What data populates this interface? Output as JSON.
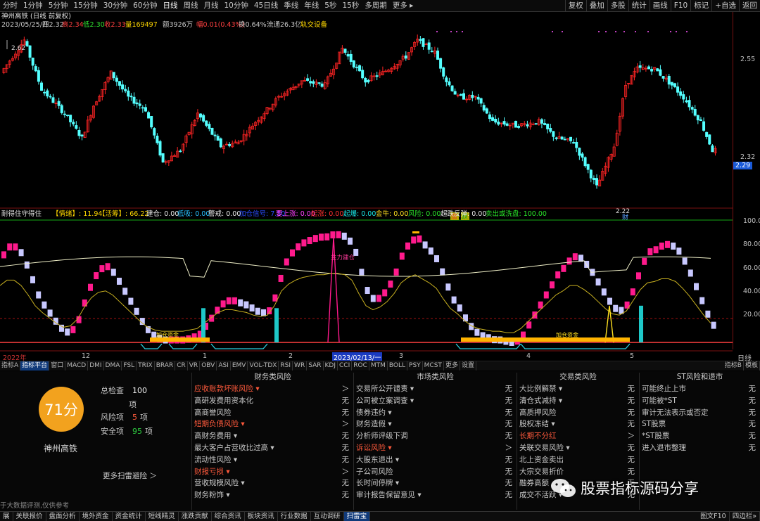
{
  "toolbar": {
    "items": [
      "分时",
      "1分钟",
      "5分钟",
      "15分钟",
      "30分钟",
      "60分钟",
      "日线",
      "周线",
      "月线",
      "10分钟",
      "45日线",
      "季线",
      "年线",
      "5秒",
      "15秒",
      "多周期",
      "更多 ▸"
    ],
    "right": [
      "复权",
      "叠加",
      "多股",
      "统计",
      "画线",
      "F10",
      "标记",
      "+自选",
      "返回"
    ]
  },
  "header": {
    "title": "神州高铁 (日线 前复权)",
    "date": "2023/05/25/四",
    "open": "开2.32",
    "high": "高2.34",
    "low": "低2.30",
    "close": "收2.33",
    "vol": "量169497",
    "amount": "额3926万",
    "change": "幅0.01(0.43%)",
    "turnover": "换0.64%",
    "float": "流通26.3亿",
    "indicator": "轨交设备"
  },
  "price_axis": {
    "labels": [
      "2.55",
      "2.32"
    ],
    "current": "2.29",
    "high_mark": "2.62",
    "low_mark": "2.22",
    "cai": "财"
  },
  "markers": {
    "rise": "涨",
    "fall": "跌"
  },
  "indicator": {
    "name": "耐得住守得住",
    "v1": "【情绪】: 11.94",
    "v2": "【活筹】: 66.22",
    "items": [
      {
        "t": "建仓: 0.00",
        "c": "#e8e8e8"
      },
      {
        "t": "低吸: 0.00",
        "c": "#28c0ff"
      },
      {
        "t": "警戒: 0.00",
        "c": "#e8e8e8"
      },
      {
        "t": "加仓信号: 7.50",
        "c": "#2a4cff"
      },
      {
        "t": "要上涨: 0.00",
        "c": "#ff40ff"
      },
      {
        "t": "起涨: 0.00",
        "c": "#ff3030"
      },
      {
        "t": "起爆: 0.00",
        "c": "#19e6e6"
      },
      {
        "t": "金牛: 0.00",
        "c": "#ffe020"
      },
      {
        "t": "风险: 0.00",
        "c": "#28e028"
      },
      {
        "t": "超跌反弹: 0.00",
        "c": "#e8e8e8"
      },
      {
        "t": "卖出或洗盘: 100.00",
        "c": "#28e028"
      }
    ],
    "axis": [
      "100.0",
      "80.00",
      "60.00",
      "40.00",
      "20.00"
    ],
    "label1": "主力建仓",
    "label2": "加仓资金"
  },
  "dates": [
    "2022年",
    "12",
    "1",
    "2",
    "2023/02/13/一",
    "3",
    "4",
    "5"
  ],
  "dates_right": "日线",
  "tabs": [
    "指标A",
    "指标平台",
    "窗口",
    "MACD",
    "DMI",
    "DMA",
    "FSL",
    "TRIX",
    "BRAR",
    "CR",
    "VR",
    "OBV",
    "ASI",
    "EMV",
    "VOL-TDX",
    "RSI",
    "WR",
    "SAR",
    "KDJ",
    "CCI",
    "ROC",
    "MTM",
    "BOLL",
    "PSY",
    "MCST",
    "更多",
    "设置"
  ],
  "tabs_right": [
    "指标B",
    "模板"
  ],
  "risk": {
    "score": "71分",
    "company": "神州高铁",
    "total_label": "总检查",
    "total": "100",
    "unit": "项",
    "risk_label": "风险项",
    "risk_count": "5",
    "risk_unit": "项",
    "safe_label": "安全项",
    "safe_count": "95",
    "safe_unit": "项",
    "more": "更多扫雷避险 ＞",
    "disclaimer": "于大数据评测,仅供参考",
    "columns": [
      {
        "title": "财务类风险",
        "rows": [
          {
            "n": "应收账款坏账风险 ▾",
            "v": "＞",
            "w": true
          },
          {
            "n": "高研发费用资本化",
            "v": "无"
          },
          {
            "n": "高商誉风险",
            "v": "无"
          },
          {
            "n": "短期负债风险 ▾",
            "v": "＞",
            "w": true
          },
          {
            "n": "高财务费用 ▾",
            "v": "无"
          },
          {
            "n": "最大客户占营收比过高 ▾",
            "v": "无"
          },
          {
            "n": "流动性风险 ▾",
            "v": "无"
          },
          {
            "n": "财报亏损 ▾",
            "v": "＞",
            "w": true
          },
          {
            "n": "营收规模风险 ▾",
            "v": "无"
          },
          {
            "n": "财务粉饰 ▾",
            "v": "无"
          }
        ]
      },
      {
        "title": "市场类风险",
        "rows": [
          {
            "n": "交易所公开谴责 ▾",
            "v": "无"
          },
          {
            "n": "公司被立案调查 ▾",
            "v": "无"
          },
          {
            "n": "债券违约 ▾",
            "v": "无"
          },
          {
            "n": "财务造假 ▾",
            "v": "无"
          },
          {
            "n": "分析师评级下调",
            "v": "无"
          },
          {
            "n": "诉讼风险 ▾",
            "v": "＞",
            "w": true
          },
          {
            "n": "大股东退出 ▾",
            "v": "无"
          },
          {
            "n": "子公司风险",
            "v": "无"
          },
          {
            "n": "长时间停牌 ▾",
            "v": "无"
          },
          {
            "n": "审计报告保留意见 ▾",
            "v": "无"
          }
        ]
      },
      {
        "title": "交易类风险",
        "rows": [
          {
            "n": "大比例解禁 ▾",
            "v": "无"
          },
          {
            "n": "清仓式减持 ▾",
            "v": "无"
          },
          {
            "n": "高质押风险",
            "v": "无"
          },
          {
            "n": "股权冻结 ▾",
            "v": "无"
          },
          {
            "n": "长期不分红",
            "v": "＞",
            "w": true
          },
          {
            "n": "关联交易风险 ▾",
            "v": "无"
          },
          {
            "n": "北上资金卖出",
            "v": "无"
          },
          {
            "n": "大宗交易折价",
            "v": "无"
          },
          {
            "n": "融券高额",
            "v": "无"
          },
          {
            "n": "成交不活跃 ▾",
            "v": "无"
          }
        ]
      },
      {
        "title": "ST风险和退市",
        "rows": [
          {
            "n": "可能终止上市",
            "v": "无"
          },
          {
            "n": "可能被*ST",
            "v": "无"
          },
          {
            "n": "审计无法表示或否定",
            "v": "无"
          },
          {
            "n": "ST股票",
            "v": "无"
          },
          {
            "n": "*ST股票",
            "v": "无"
          },
          {
            "n": "进入退市整理",
            "v": "无"
          }
        ]
      }
    ]
  },
  "watermark": "股票指标源码分享",
  "bottom": {
    "items": [
      "展",
      "关联报价",
      "盘面分析",
      "境外资金",
      "资金统计",
      "短线精灵",
      "涨跌贡献",
      "综合资讯",
      "板块资讯",
      "行业数据",
      "互动调研",
      "扫雷宝"
    ],
    "right": [
      "图文F10",
      "四边栏»"
    ]
  },
  "colors": {
    "up": "#ff2424",
    "down": "#54ffff",
    "magenta": "#ff1a8c",
    "lavender": "#c8c8ff",
    "teal": "#1ec8c8",
    "orange": "#ffb400"
  }
}
